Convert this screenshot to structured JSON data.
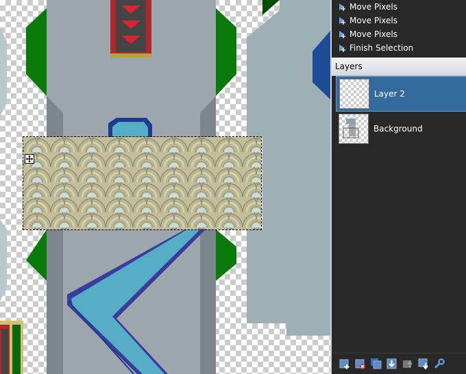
{
  "history": {
    "items": [
      {
        "label": "Move Pixels",
        "icon": "move-pixels-icon"
      },
      {
        "label": "Move Pixels",
        "icon": "move-pixels-icon"
      },
      {
        "label": "Move Pixels",
        "icon": "move-pixels-icon"
      },
      {
        "label": "Finish Selection",
        "icon": "finish-selection-icon"
      }
    ]
  },
  "layers": {
    "title": "Layers",
    "items": [
      {
        "name": "Layer 2",
        "selected": true
      },
      {
        "name": "Background",
        "selected": false
      }
    ],
    "toolbar": [
      "add-layer-icon",
      "delete-layer-icon",
      "duplicate-layer-icon",
      "merge-layer-down-icon",
      "move-layer-up-icon",
      "move-layer-down-icon",
      "layer-properties-icon"
    ]
  },
  "colors": {
    "panel_bg": "#282828",
    "selected_row": "#33699c",
    "river": "#56aec6",
    "road": "#9da5ad",
    "grass": "#0a7a0a",
    "arrow_red": "#d6272d"
  }
}
